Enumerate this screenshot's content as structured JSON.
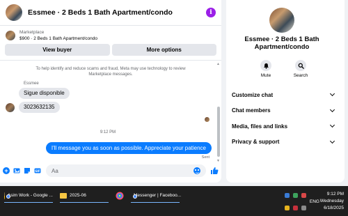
{
  "chat": {
    "title": "Essmee · 2 Beds 1 Bath Apartment/condo",
    "info_icon": "i",
    "listing": {
      "kicker": "Marketplace",
      "subtitle": "$900 · 2 Beds 1 Bath Apartment/condo"
    },
    "buttons": {
      "view_buyer": "View buyer",
      "more_options": "More options"
    },
    "notice": "To help identify and reduce scams and fraud, Meta may use technology to review Marketplace messages.",
    "sender_name": "Essmee",
    "messages_in": [
      "Sigue disponible",
      "3023632135"
    ],
    "timestamp": "9:12 PM",
    "message_out": "I'll message you as soon as possible. Appreciate your patience",
    "sent_label": "Sent",
    "composer_placeholder": "Aa",
    "accent_color": "#0a7cff"
  },
  "info_panel": {
    "title": "Essmee · 2 Beds 1 Bath Apartment/condo",
    "actions": [
      {
        "label": "Mute",
        "icon": "bell-icon"
      },
      {
        "label": "Search",
        "icon": "search-icon"
      }
    ],
    "menu": [
      "Customize chat",
      "Chat members",
      "Media, files and links",
      "Privacy & support"
    ]
  },
  "taskbar": {
    "tasks": [
      {
        "label": "Asim Work - Google ...",
        "icon": "chrome-icon"
      },
      {
        "label": "2025-06",
        "icon": "folder-icon"
      },
      {
        "label": "",
        "icon": "colorful-app-icon"
      },
      {
        "label": "Messenger | Faceboo...",
        "icon": "chrome-icon"
      }
    ],
    "language": "ENG",
    "time": "9:12 PM",
    "day": "Wednesday",
    "date": "6/18/2025"
  }
}
